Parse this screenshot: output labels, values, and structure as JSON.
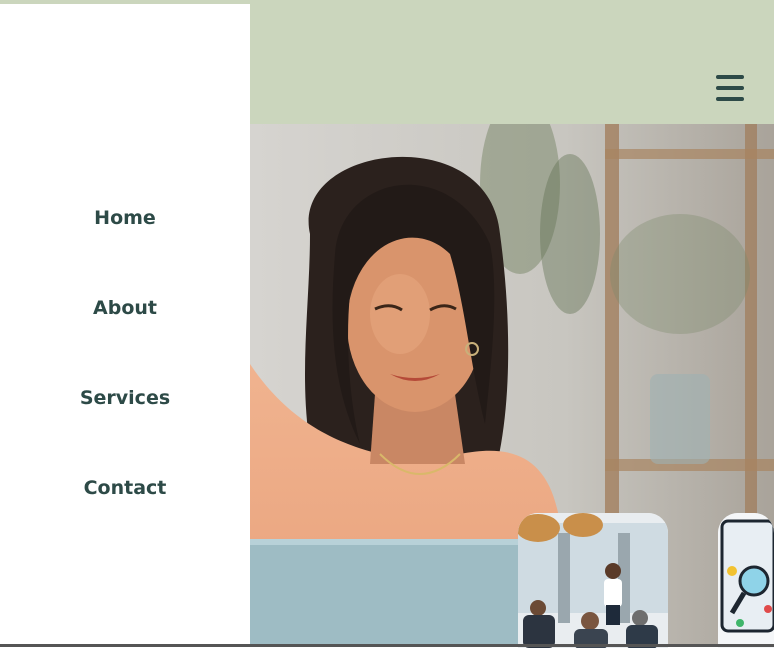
{
  "nav": {
    "items": [
      {
        "label": "Home"
      },
      {
        "label": "About"
      },
      {
        "label": "Services"
      },
      {
        "label": "Contact"
      }
    ]
  },
  "header": {
    "menu_icon": "hamburger-menu-icon"
  },
  "colors": {
    "header_bg": "#cbd6bd",
    "nav_text": "#2d4a47",
    "sidebar_bg": "#ffffff"
  },
  "images": {
    "hero": "woman-smiling-at-laptop",
    "thumbnail_1": "presenter-in-meeting-room",
    "thumbnail_2": "magnifying-glass-illustration"
  }
}
